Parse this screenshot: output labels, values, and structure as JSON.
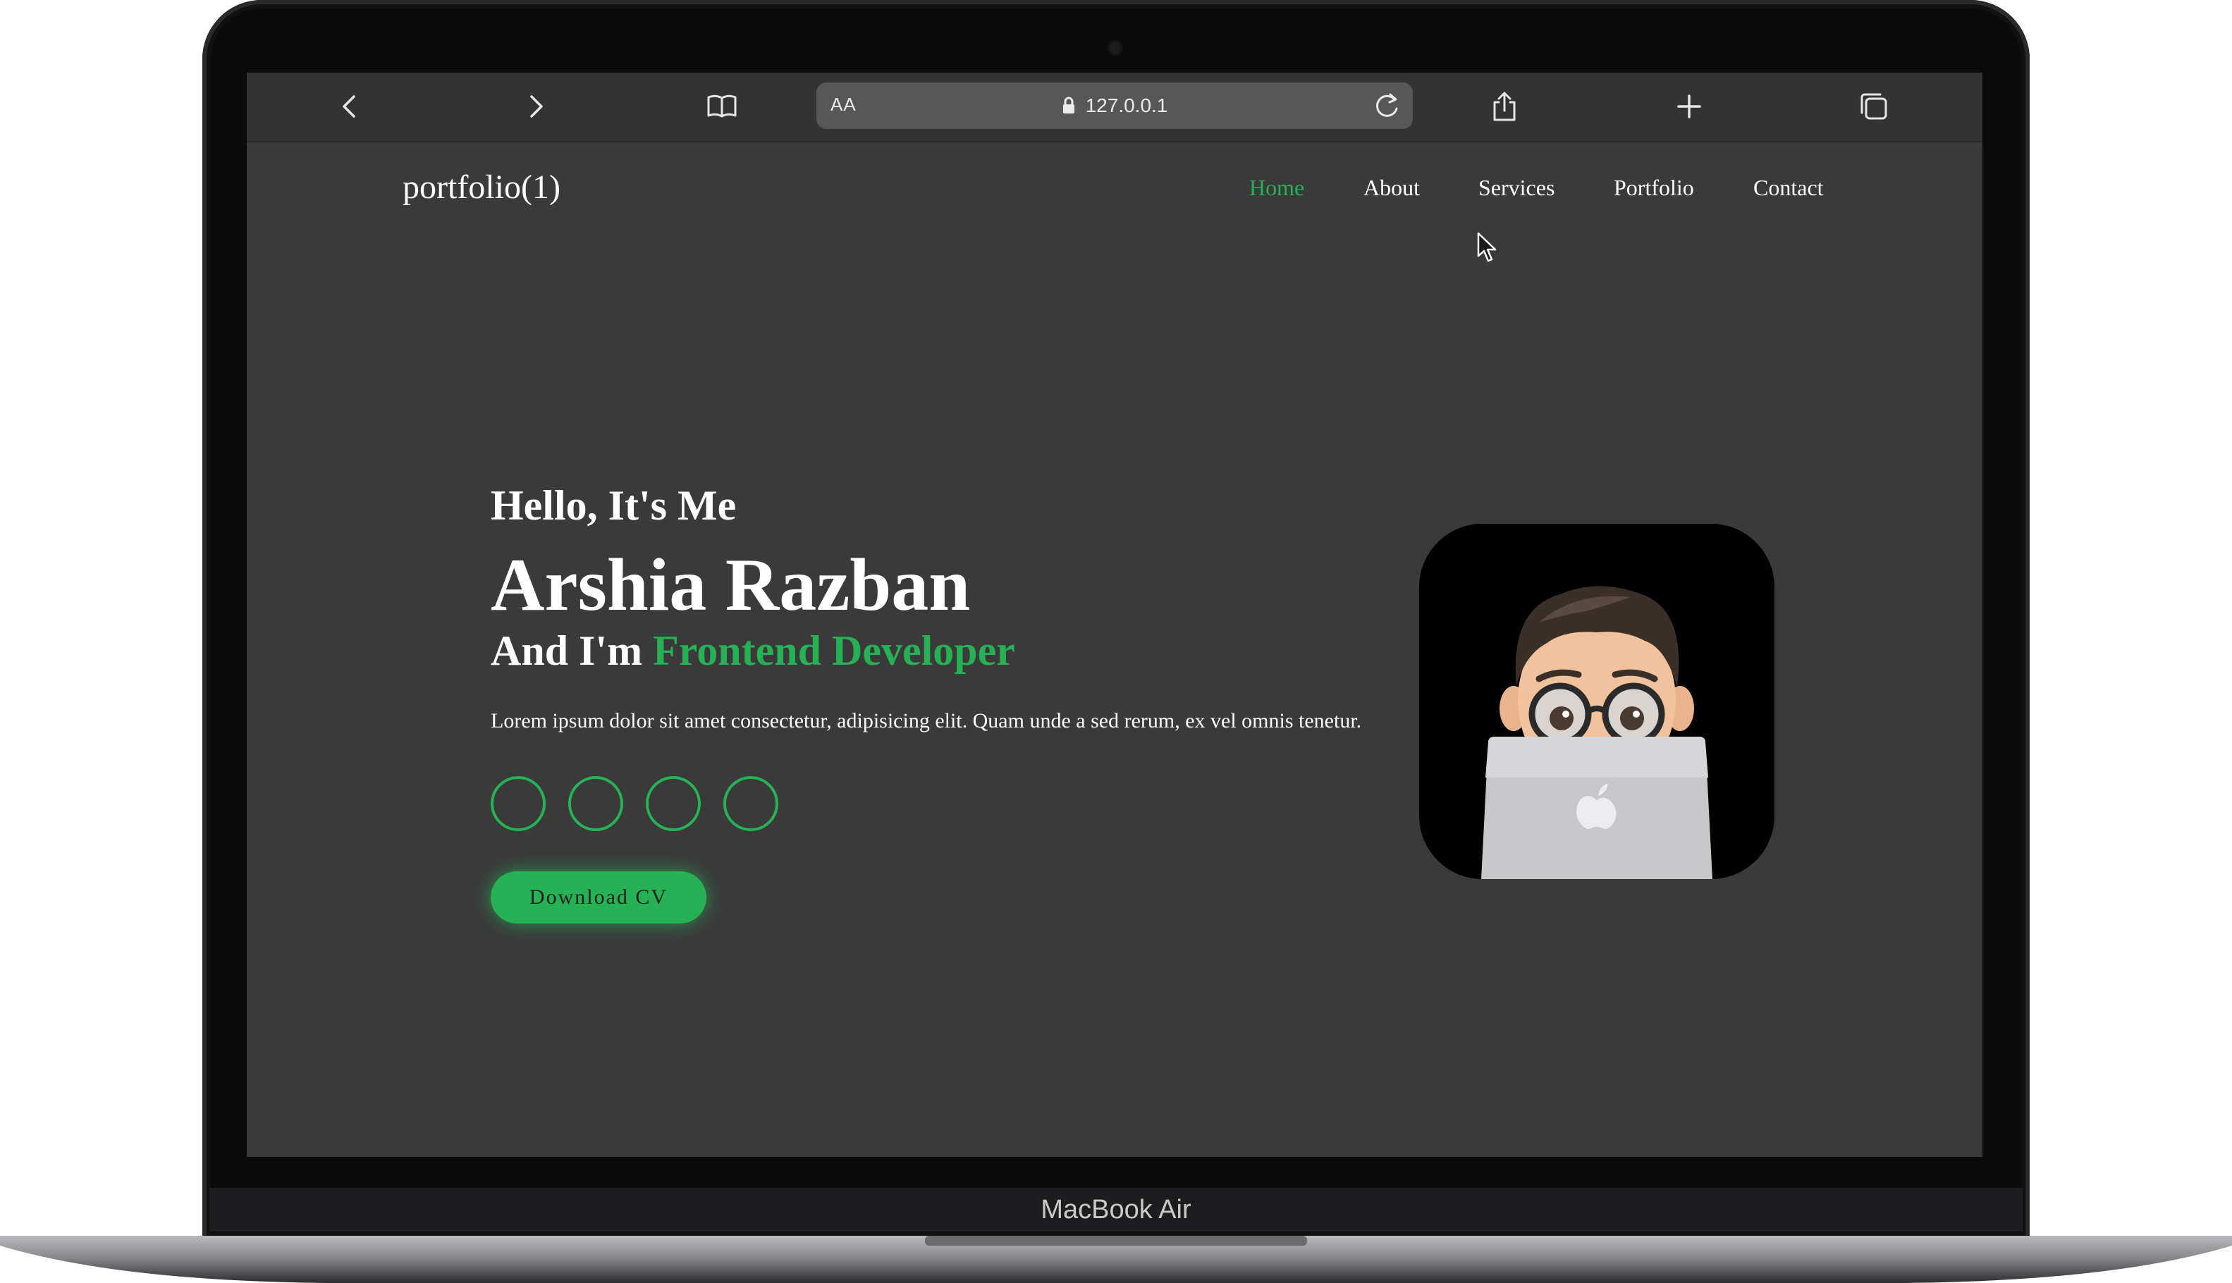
{
  "device": {
    "label": "MacBook Air"
  },
  "browser": {
    "text_size_label": "AA",
    "url": "127.0.0.1",
    "icons": [
      "back-icon",
      "forward-icon",
      "bookmarks-icon",
      "lock-icon",
      "reload-icon",
      "share-icon",
      "new-tab-icon",
      "tabs-icon"
    ]
  },
  "site": {
    "logo": "portfolio(1)",
    "nav": [
      {
        "label": "Home",
        "active": true
      },
      {
        "label": "About",
        "active": false
      },
      {
        "label": "Services",
        "active": false
      },
      {
        "label": "Portfolio",
        "active": false
      },
      {
        "label": "Contact",
        "active": false
      }
    ],
    "hero": {
      "greeting": "Hello, It's Me",
      "name": "Arshia Razban",
      "role_prefix": "And I'm ",
      "role_highlight": "Frontend Developer",
      "description": "Lorem ipsum dolor sit amet consectetur, adipisicing elit. Quam unde a sed rerum, ex vel omnis tenetur.",
      "social_count": 4,
      "cta_label": "Download CV",
      "avatar_icon": "memoji-avatar-with-laptop"
    },
    "colors": {
      "accent": "#27b155",
      "background": "#3a3a3a",
      "text": "#ffffff"
    }
  }
}
